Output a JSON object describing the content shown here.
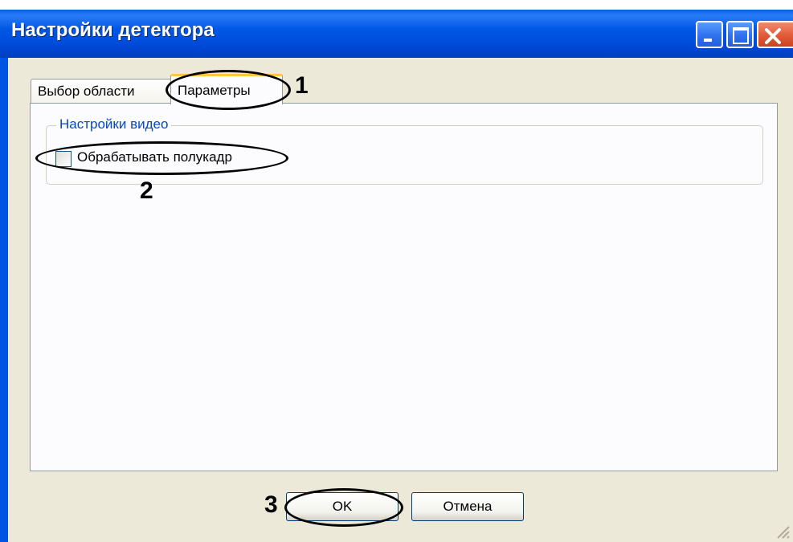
{
  "window": {
    "title": "Настройки детектора"
  },
  "tabs": [
    {
      "label": "Выбор области",
      "selected": false
    },
    {
      "label": "Параметры",
      "selected": true
    }
  ],
  "group": {
    "label": "Настройки видео"
  },
  "checkbox": {
    "label": "Обрабатывать полукадр",
    "checked": false
  },
  "buttons": {
    "ok_label": "OK",
    "cancel_label": "Отмена"
  },
  "markers": [
    "1",
    "2",
    "3"
  ],
  "colors": {
    "titlebar": "#0054e3",
    "dialog_bg": "#ece9d8",
    "group_label": "#0046d5",
    "tab_highlight": "#ffc83c",
    "close_button": "#e35a36"
  }
}
